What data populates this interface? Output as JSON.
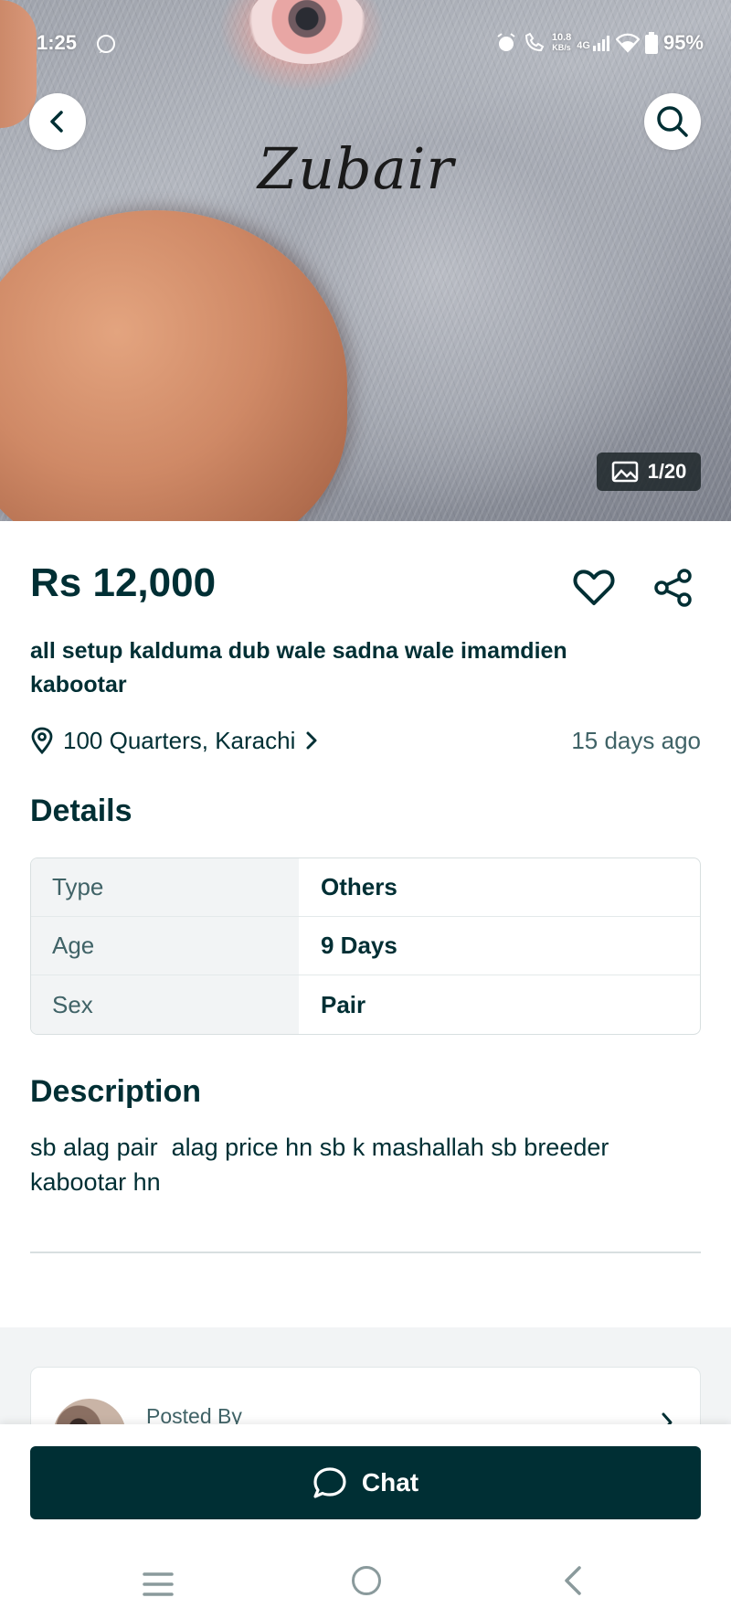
{
  "status_bar": {
    "time": "1:25",
    "network_speed_value": "10.8",
    "network_speed_unit": "KB/s",
    "network_type": "4G",
    "battery": "95%"
  },
  "hero": {
    "watermark": "Zubair",
    "image_counter": "1/20"
  },
  "listing": {
    "price": "Rs 12,000",
    "title": "all setup kalduma dub wale sadna wale imamdien kabootar",
    "location": "100 Quarters, Karachi",
    "posted_ago": "15 days ago"
  },
  "details": {
    "heading": "Details",
    "rows": [
      {
        "key": "Type",
        "value": "Others"
      },
      {
        "key": "Age",
        "value": "9 Days"
      },
      {
        "key": "Sex",
        "value": "Pair"
      }
    ]
  },
  "description": {
    "heading": "Description",
    "text": "sb alag pair  alag price hn sb k mashallah sb breeder kabootar hn"
  },
  "seller": {
    "posted_by_label": "Posted By"
  },
  "actions": {
    "chat_label": "Chat"
  },
  "colors": {
    "primary": "#002f34",
    "muted_text": "#406367",
    "table_key_bg": "#f2f4f5",
    "border": "#d8dfe0"
  },
  "icons": [
    "back-arrow-icon",
    "search-icon",
    "gallery-icon",
    "heart-icon",
    "share-icon",
    "location-pin-icon",
    "chevron-right-icon",
    "chat-bubble-icon",
    "menu-icon",
    "home-icon",
    "back-icon"
  ]
}
